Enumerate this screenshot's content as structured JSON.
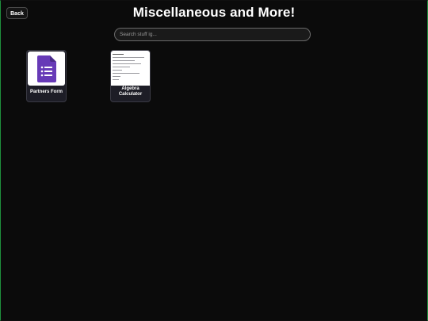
{
  "header": {
    "back_label": "Back",
    "title": "Miscellaneous and More!"
  },
  "search": {
    "placeholder": "Search stuff ig..."
  },
  "cards": [
    {
      "label": "Partners Form",
      "icon": "google-forms-icon"
    },
    {
      "label": "Algebra Calculator",
      "icon": "algebra-calculator-thumbnail"
    }
  ],
  "colors": {
    "background": "#0b0b0b",
    "card": "#1d1d26",
    "forms_purple": "#673ab7",
    "frame_green": "#1f8f3c"
  }
}
